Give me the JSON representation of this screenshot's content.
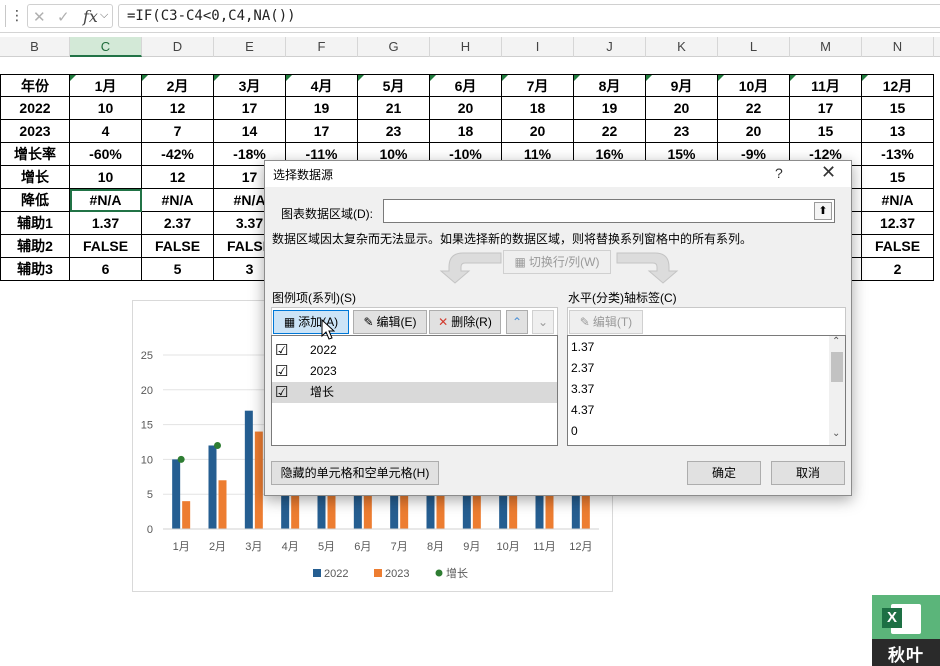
{
  "formula_bar": {
    "fx": "fx",
    "formula": "=IF(C3-C4<0,C4,NA())"
  },
  "columns": [
    "B",
    "C",
    "D",
    "E",
    "F",
    "G",
    "H",
    "I",
    "J",
    "K",
    "L",
    "M",
    "N"
  ],
  "table": {
    "rows": [
      [
        "年份",
        "1月",
        "2月",
        "3月",
        "4月",
        "5月",
        "6月",
        "7月",
        "8月",
        "9月",
        "10月",
        "11月",
        "12月"
      ],
      [
        "2022",
        "10",
        "12",
        "17",
        "19",
        "21",
        "20",
        "18",
        "19",
        "20",
        "22",
        "17",
        "15"
      ],
      [
        "2023",
        "4",
        "7",
        "14",
        "17",
        "23",
        "18",
        "20",
        "22",
        "23",
        "20",
        "15",
        "13"
      ],
      [
        "增长率",
        "-60%",
        "-42%",
        "-18%",
        "-11%",
        "10%",
        "-10%",
        "11%",
        "16%",
        "15%",
        "-9%",
        "-12%",
        "-13%"
      ],
      [
        "增长",
        "10",
        "12",
        "17",
        "",
        "",
        "",
        "",
        "",
        "",
        "",
        "",
        "15"
      ],
      [
        "降低",
        "#N/A",
        "#N/A",
        "#N/A",
        "",
        "",
        "",
        "",
        "",
        "",
        "",
        "",
        "#N/A"
      ],
      [
        "辅助1",
        "1.37",
        "2.37",
        "3.37",
        "",
        "",
        "",
        "",
        "",
        "",
        "",
        "",
        "12.37"
      ],
      [
        "辅助2",
        "FALSE",
        "FALSE",
        "FALSE",
        "",
        "",
        "",
        "",
        "",
        "",
        "",
        "",
        "FALSE"
      ],
      [
        "辅助3",
        "6",
        "5",
        "3",
        "",
        "",
        "",
        "",
        "",
        "",
        "",
        "",
        "2"
      ]
    ]
  },
  "chart_data": {
    "type": "bar",
    "categories": [
      "1月",
      "2月",
      "3月",
      "4月",
      "5月",
      "6月",
      "7月",
      "8月",
      "9月",
      "10月",
      "11月",
      "12月"
    ],
    "series": [
      {
        "name": "2022",
        "type": "bar",
        "color": "#255e91",
        "values": [
          10,
          12,
          17,
          19,
          21,
          20,
          18,
          19,
          20,
          22,
          17,
          15
        ]
      },
      {
        "name": "2023",
        "type": "bar",
        "color": "#ed7d31",
        "values": [
          4,
          7,
          14,
          17,
          23,
          18,
          20,
          22,
          23,
          20,
          15,
          13
        ]
      },
      {
        "name": "增长",
        "type": "scatter",
        "color": "#2e7d32",
        "values": [
          10,
          12
        ]
      }
    ],
    "yticks": [
      "0",
      "5",
      "10",
      "15",
      "20",
      "25"
    ],
    "ylim": [
      0,
      25
    ],
    "legend_position": "bottom",
    "grid": true
  },
  "dialog": {
    "title": "选择数据源",
    "help": "?",
    "close": "✕",
    "range_label": "图表数据区域(D):",
    "range_value": "",
    "message": "数据区域因太复杂而无法显示。如果选择新的数据区域，则将替换系列窗格中的所有系列。",
    "switch_label": "切换行/列(W)",
    "legend_title": "图例项(系列)(S)",
    "add_label": "添加(A)",
    "edit_label": "编辑(E)",
    "delete_label": "删除(R)",
    "series": [
      {
        "name": "2022",
        "checked": "☑"
      },
      {
        "name": "2023",
        "checked": "☑"
      },
      {
        "name": "增长",
        "checked": "☑"
      }
    ],
    "axis_title": "水平(分类)轴标签(C)",
    "axis_edit_label": "编辑(T)",
    "axis_labels": [
      "1.37",
      "2.37",
      "3.37",
      "4.37",
      "0"
    ],
    "hidden_cells_label": "隐藏的单元格和空单元格(H)",
    "ok_label": "确定",
    "cancel_label": "取消"
  },
  "logo": {
    "letter": "X",
    "text": "秋叶"
  }
}
